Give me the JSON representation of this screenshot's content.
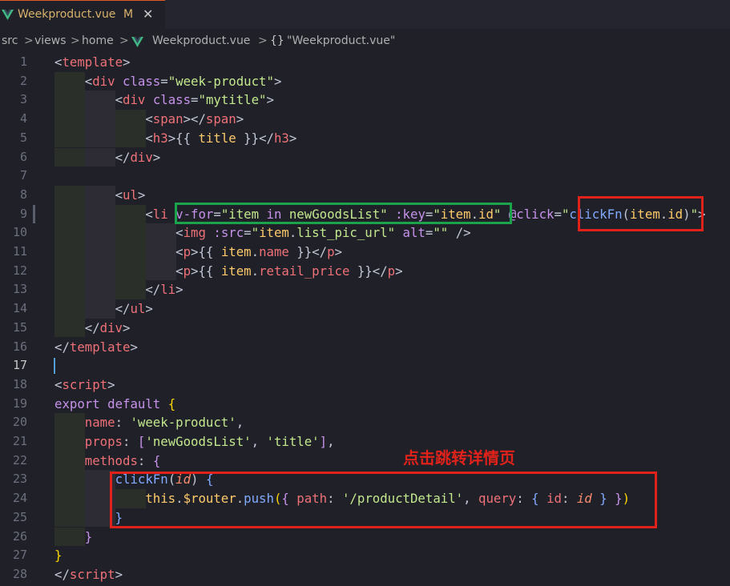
{
  "tab": {
    "filename": "Weekproduct.vue",
    "modified_marker": "M",
    "close_glyph": "✕"
  },
  "breadcrumb": {
    "parts": [
      "src",
      "views",
      "home",
      "Weekproduct.vue",
      "\"Weekproduct.vue\""
    ],
    "separator": ">",
    "braces": "{}"
  },
  "annotation": {
    "label": "点击跳转详情页",
    "color": "#e0221b"
  },
  "highlight_colors": {
    "green_box": "#1aa34a",
    "red_box": "#e0221b",
    "cursor": "#569cd6"
  },
  "editor": {
    "active_line": 17,
    "lines": [
      {
        "n": "1",
        "html": "<span class=\"pu\">&lt;</span><span class=\"tg\">template</span><span class=\"pu\">&gt;</span>"
      },
      {
        "n": "2",
        "html": "    <span class=\"pu\">&lt;</span><span class=\"tg\">div</span> <span class=\"at\">class</span><span class=\"pu\">=</span><span class=\"st\">\"week-product\"</span><span class=\"pu\">&gt;</span>"
      },
      {
        "n": "3",
        "html": "        <span class=\"pu\">&lt;</span><span class=\"tg\">div</span> <span class=\"at\">class</span><span class=\"pu\">=</span><span class=\"st\">\"mytitle\"</span><span class=\"pu\">&gt;</span>"
      },
      {
        "n": "4",
        "html": "            <span class=\"pu\">&lt;</span><span class=\"tg\">span</span><span class=\"pu\">&gt;&lt;/</span><span class=\"tg\">span</span><span class=\"pu\">&gt;</span>"
      },
      {
        "n": "5",
        "html": "            <span class=\"pu\">&lt;</span><span class=\"tg\">h3</span><span class=\"pu\">&gt;</span><span class=\"pu\">{{ </span><span class=\"ye\">title</span><span class=\"pu\"> }}</span><span class=\"pu\">&lt;/</span><span class=\"tg\">h3</span><span class=\"pu\">&gt;</span>"
      },
      {
        "n": "6",
        "html": "        <span class=\"pu\">&lt;/</span><span class=\"tg\">div</span><span class=\"pu\">&gt;</span>"
      },
      {
        "n": "7",
        "html": ""
      },
      {
        "n": "8",
        "html": "        <span class=\"pu\">&lt;</span><span class=\"tg\">ul</span><span class=\"pu\">&gt;</span>"
      },
      {
        "n": "9",
        "html": "            <span class=\"pu\">&lt;</span><span class=\"tg\">li</span> <span class=\"at\">v-for</span><span class=\"pu\">=</span><span class=\"st\">\"</span><span class=\"st\">item</span> <span class=\"kw\">in</span> <span class=\"st\">newGoodsList</span><span class=\"st\">\"</span> <span class=\"at\">:key</span><span class=\"pu\">=</span><span class=\"st\">\"</span><span class=\"ye\">item</span><span class=\"pu\">.</span><span class=\"ye\">id</span><span class=\"st\">\"</span> <span class=\"at\">@click</span><span class=\"pu\">=</span><span class=\"st\">\"</span><span class=\"fn\">clickFn</span><span class=\"pu\">(</span><span class=\"ye\">item</span><span class=\"pu\">.</span><span class=\"ye\">id</span><span class=\"pu\">)</span><span class=\"st\">\"</span><span class=\"pu\">&gt;</span>"
      },
      {
        "n": "10",
        "html": "                <span class=\"pu\">&lt;</span><span class=\"tg\">img</span> <span class=\"at\">:src</span><span class=\"pu\">=</span><span class=\"st\">\"</span><span class=\"ye\">item</span><span class=\"pu\">.</span><span class=\"st\">list_pic_url</span><span class=\"st\">\"</span> <span class=\"at\">alt</span><span class=\"pu\">=</span><span class=\"st\">\"\"</span> <span class=\"pu\">/&gt;</span>"
      },
      {
        "n": "11",
        "html": "                <span class=\"pu\">&lt;</span><span class=\"tg\">p</span><span class=\"pu\">&gt;</span><span class=\"pu\">{{ </span><span class=\"ye\">item</span><span class=\"pu\">.</span><span class=\"pr\">name</span><span class=\"pu\"> }}</span><span class=\"pu\">&lt;/</span><span class=\"tg\">p</span><span class=\"pu\">&gt;</span>"
      },
      {
        "n": "12",
        "html": "                <span class=\"pu\">&lt;</span><span class=\"tg\">p</span><span class=\"pu\">&gt;</span><span class=\"pu\">{{ </span><span class=\"ye\">item</span><span class=\"pu\">.</span><span class=\"pr\">retail_price</span><span class=\"pu\"> }}</span><span class=\"pu\">&lt;/</span><span class=\"tg\">p</span><span class=\"pu\">&gt;</span>"
      },
      {
        "n": "13",
        "html": "            <span class=\"pu\">&lt;/</span><span class=\"tg\">li</span><span class=\"pu\">&gt;</span>"
      },
      {
        "n": "14",
        "html": "        <span class=\"pu\">&lt;/</span><span class=\"tg\">ul</span><span class=\"pu\">&gt;</span>"
      },
      {
        "n": "15",
        "html": "    <span class=\"pu\">&lt;/</span><span class=\"tg\">div</span><span class=\"pu\">&gt;</span>"
      },
      {
        "n": "16",
        "html": "<span class=\"pu\">&lt;/</span><span class=\"tg\">template</span><span class=\"pu\">&gt;</span>"
      },
      {
        "n": "17",
        "html": ""
      },
      {
        "n": "18",
        "html": "<span class=\"pu\">&lt;</span><span class=\"tg\">script</span><span class=\"pu\">&gt;</span>"
      },
      {
        "n": "19",
        "html": "<span class=\"kw\">export</span> <span class=\"kw\">default</span> <span class=\"br\">{</span>"
      },
      {
        "n": "20",
        "html": "    <span class=\"pr\">name</span><span class=\"pu\">:</span> <span class=\"st\">'week-product'</span><span class=\"pu\">,</span>"
      },
      {
        "n": "21",
        "html": "    <span class=\"pr\">props</span><span class=\"pu\">:</span> <span class=\"at\">[</span><span class=\"st\">'newGoodsList'</span><span class=\"pu\">,</span> <span class=\"st\">'title'</span><span class=\"at\">]</span><span class=\"pu\">,</span>"
      },
      {
        "n": "22",
        "html": "    <span class=\"pr\">methods</span><span class=\"pu\">:</span> <span class=\"at\">{</span>"
      },
      {
        "n": "23",
        "html": "        <span class=\"fn\">clickFn</span><span class=\"pu\">(</span><span class=\"it\">id</span><span class=\"pu\">)</span> <span class=\"fn\">{</span>"
      },
      {
        "n": "24",
        "html": "            <span class=\"ye\">this</span><span class=\"pu\">.</span><span class=\"ye\">$router</span><span class=\"pu\">.</span><span class=\"fn\">push</span><span class=\"br\">(</span><span class=\"at\">{</span> <span class=\"pr\">path</span><span class=\"pu\">:</span> <span class=\"st\">'/productDetail'</span><span class=\"pu\">,</span> <span class=\"pr\">query</span><span class=\"pu\">:</span> <span class=\"fn\">{</span> <span class=\"pr\">id</span><span class=\"pu\">:</span> <span class=\"it\">id</span> <span class=\"fn\">}</span> <span class=\"at\">}</span><span class=\"br\">)</span>"
      },
      {
        "n": "25",
        "html": "        <span class=\"fn\">}</span>"
      },
      {
        "n": "26",
        "html": "    <span class=\"at\">}</span>"
      },
      {
        "n": "27",
        "html": "<span class=\"br\">}</span>"
      },
      {
        "n": "28",
        "html": "<span class=\"pu\">&lt;/</span><span class=\"tg\">script</span><span class=\"pu\">&gt;</span>"
      }
    ]
  }
}
